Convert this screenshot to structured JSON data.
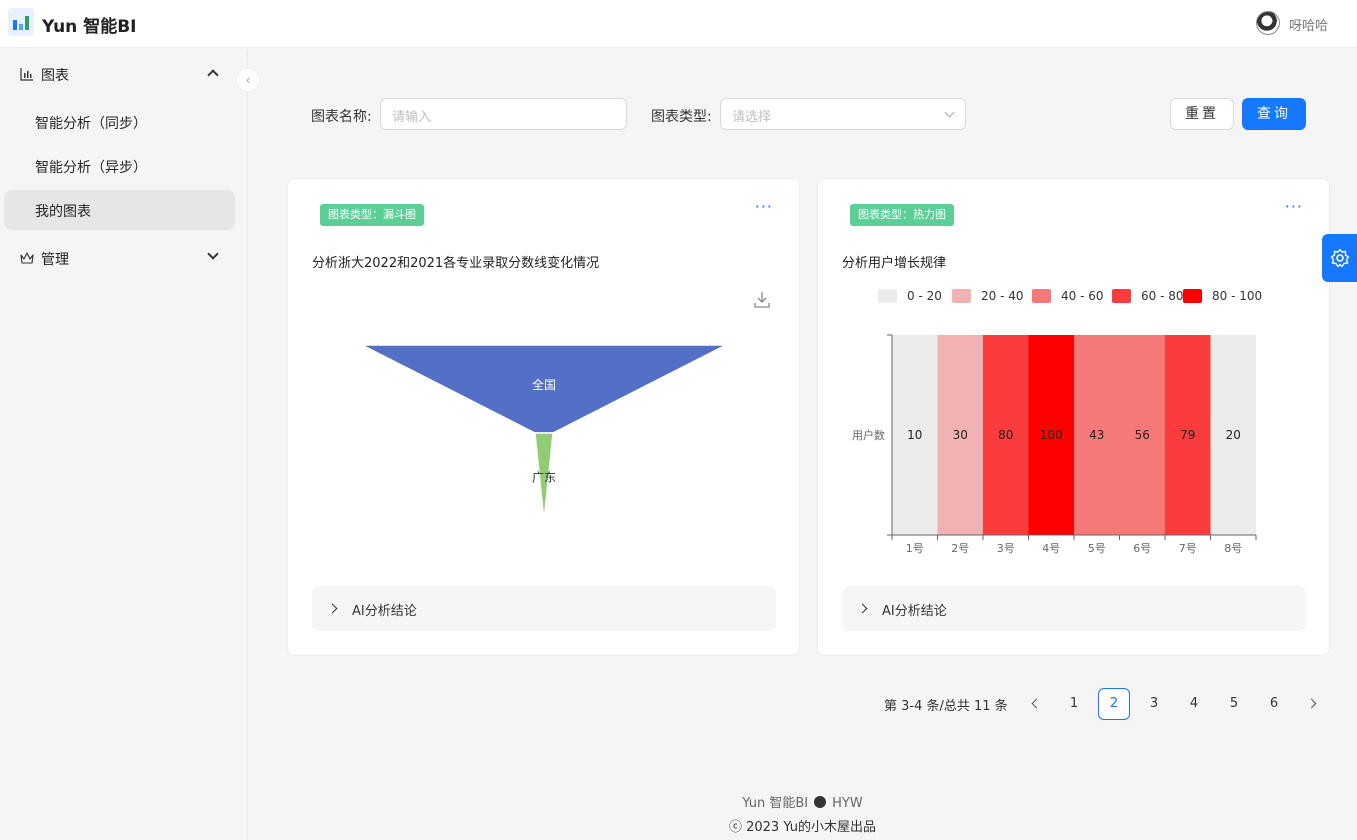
{
  "app": {
    "title": "Yun 智能BI",
    "user": "呀哈哈"
  },
  "sidebar": {
    "groups": [
      {
        "label": "图表",
        "icon": "bar-chart-icon",
        "expanded": true
      },
      {
        "label": "管理",
        "icon": "crown-icon",
        "expanded": false
      }
    ],
    "items": [
      {
        "label": "智能分析（同步）",
        "active": false
      },
      {
        "label": "智能分析（异步）",
        "active": false
      },
      {
        "label": "我的图表",
        "active": true
      }
    ]
  },
  "search": {
    "name_label": "图表名称:",
    "name_placeholder": "请输入",
    "type_label": "图表类型:",
    "type_placeholder": "请选择",
    "reset_label": "重置",
    "query_label": "查询"
  },
  "cards": [
    {
      "tag": "图表类型：漏斗图",
      "title": "分析浙大2022和2021各专业录取分数线变化情况",
      "conclusion_label": "AI分析结论",
      "chart_data": {
        "type": "funnel",
        "title": "",
        "series": [
          {
            "name": "全国",
            "value": 100
          },
          {
            "name": "广东",
            "value": 5
          }
        ],
        "colors": [
          "#5470c6",
          "#91cc75"
        ]
      }
    },
    {
      "tag": "图表类型：热力图",
      "title": "分析用户增长规律",
      "conclusion_label": "AI分析结论",
      "chart_data": {
        "type": "heatmap",
        "title": "",
        "ylabel_category": "用户数",
        "categories": [
          "1号",
          "2号",
          "3号",
          "4号",
          "5号",
          "6号",
          "7号",
          "8号"
        ],
        "values": [
          10,
          30,
          80,
          100,
          43,
          56,
          79,
          20
        ],
        "legend": [
          {
            "label": "0 - 20",
            "color": "#ebebeb"
          },
          {
            "label": "20 - 40",
            "color": "#f0b2b2"
          },
          {
            "label": "40 - 60",
            "color": "#f57979"
          },
          {
            "label": "60 - 80",
            "color": "#fa3c3c"
          },
          {
            "label": "80 - 100",
            "color": "#ff0000"
          }
        ],
        "legend_position": "top"
      }
    }
  ],
  "pagination": {
    "total_text": "第 3-4 条/总共 11 条",
    "pages": [
      "1",
      "2",
      "3",
      "4",
      "5",
      "6"
    ],
    "current": "2"
  },
  "footer": {
    "line1_left": "Yun 智能BI",
    "line1_right": "HYW",
    "line2": "ⓒ 2023 Yu的小木屋出品"
  }
}
